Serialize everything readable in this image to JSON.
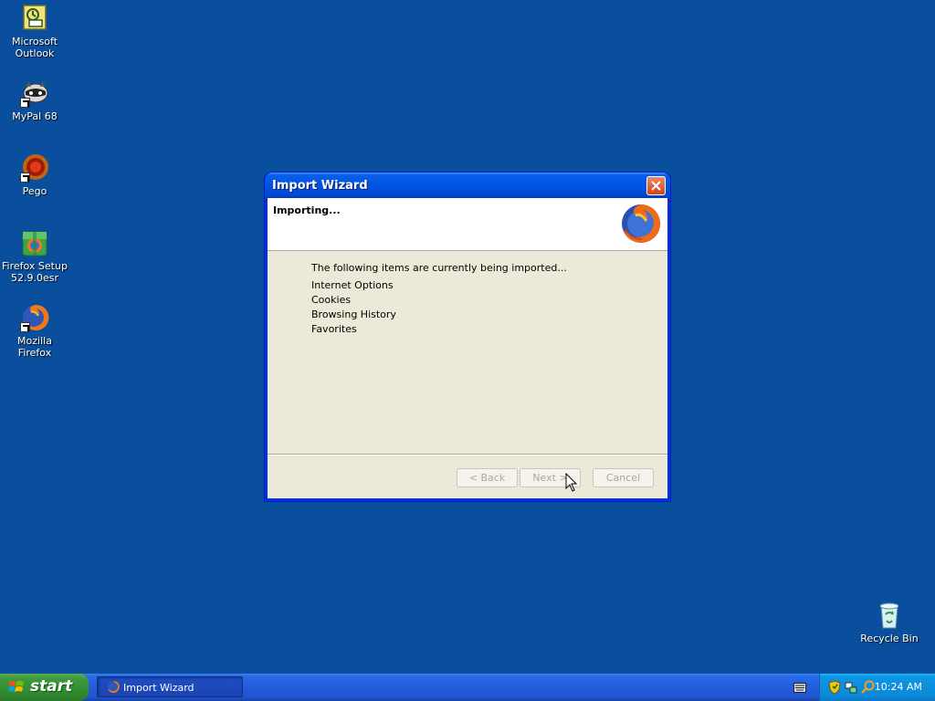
{
  "desktop": {
    "icons": [
      {
        "label_line1": "Microsoft",
        "label_line2": "Outlook"
      },
      {
        "label_line1": "MyPal 68",
        "label_line2": ""
      },
      {
        "label_line1": "Pego",
        "label_line2": ""
      },
      {
        "label_line1": "Firefox Setup",
        "label_line2": "52.9.0esr"
      },
      {
        "label_line1": "Mozilla Firefox",
        "label_line2": ""
      }
    ],
    "recycle_bin": "Recycle Bin"
  },
  "dialog": {
    "title": "Import Wizard",
    "header": "Importing...",
    "intro": "The following items are currently being imported...",
    "items": [
      "Internet Options",
      "Cookies",
      "Browsing History",
      "Favorites"
    ],
    "buttons": {
      "back": "< Back",
      "next": "Next >",
      "cancel": "Cancel"
    }
  },
  "taskbar": {
    "start_label": "start",
    "task_label": "Import Wizard",
    "clock": "10:24 AM"
  },
  "colors": {
    "desktop": "#0a4f9e",
    "titlebar": "#0054e3",
    "dialog_bg": "#ece9d8"
  }
}
